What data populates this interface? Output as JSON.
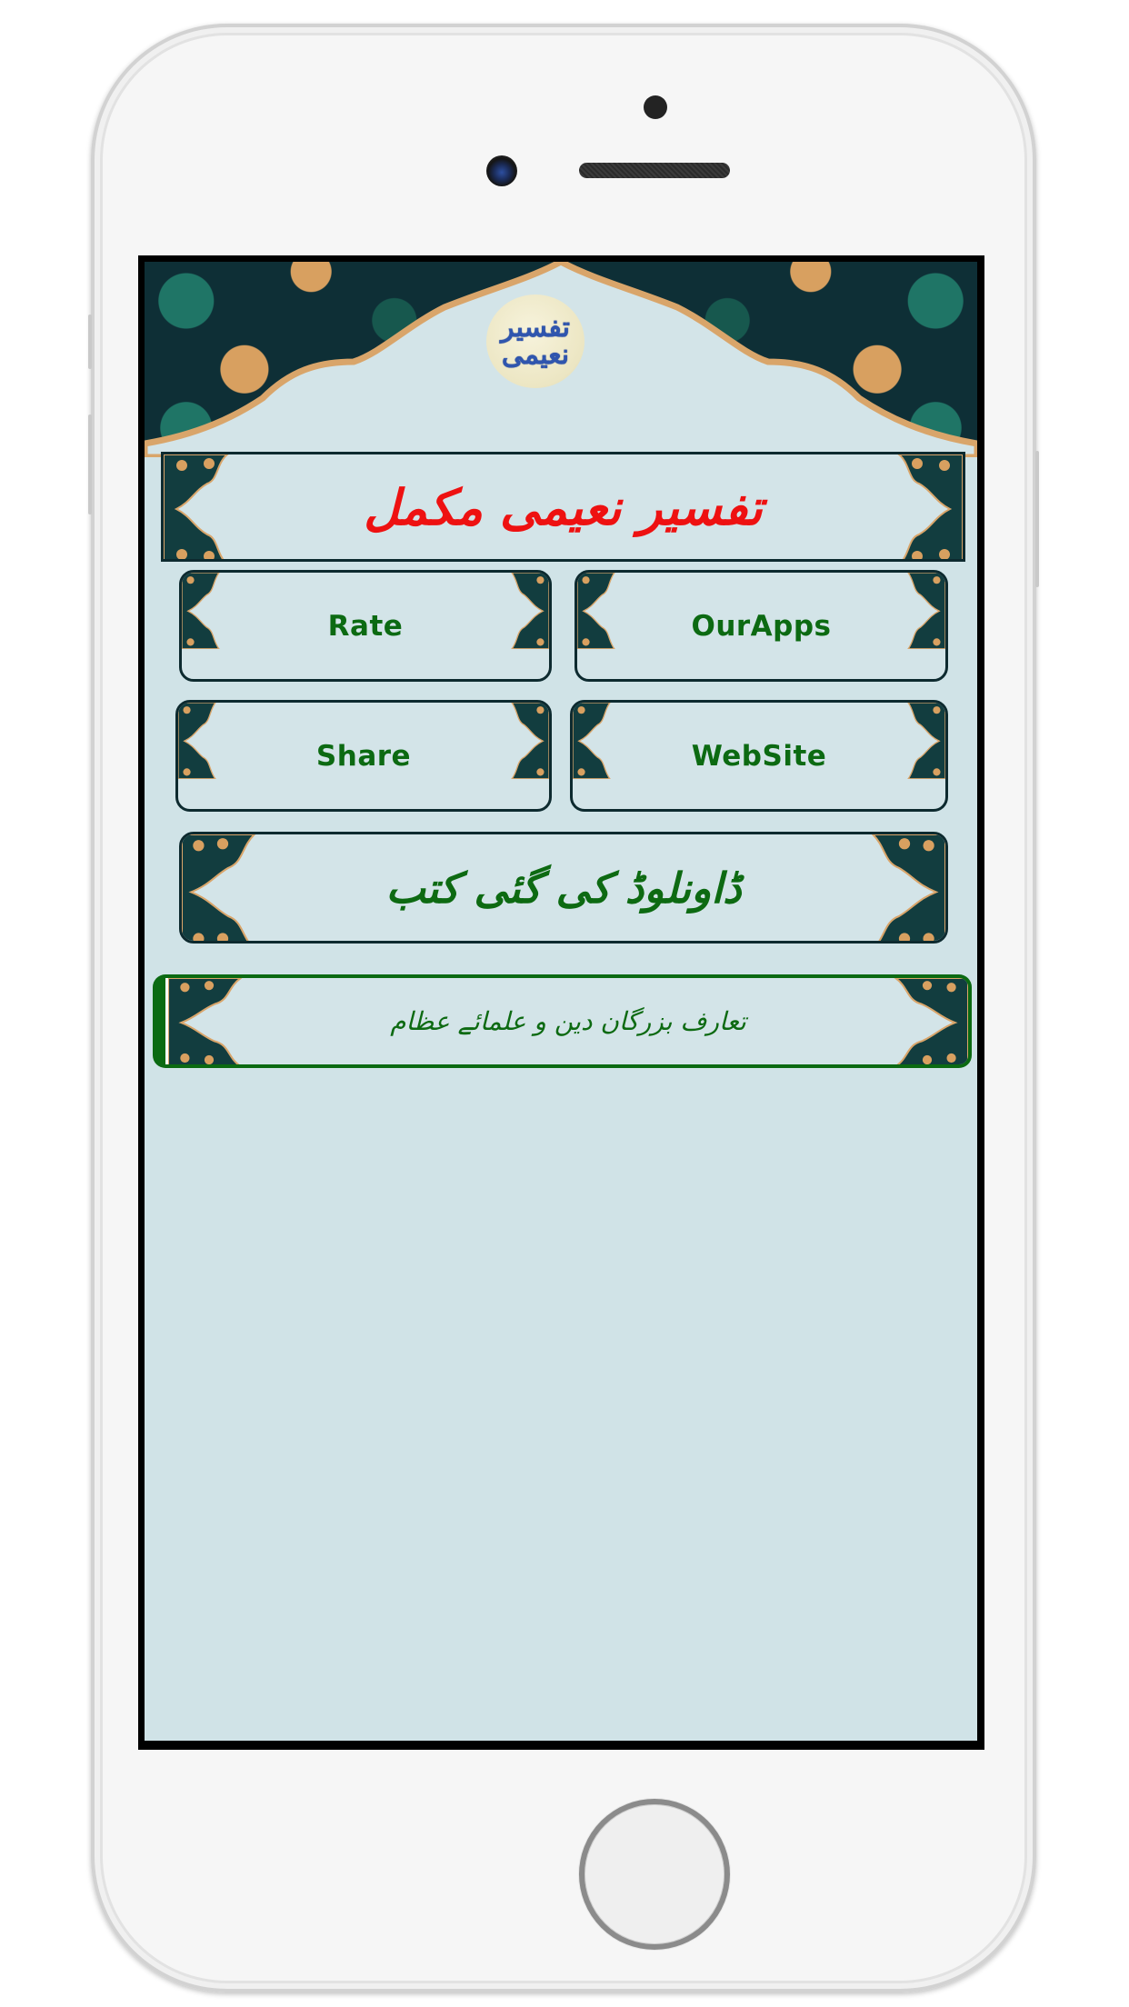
{
  "app": {
    "logo_text": "تفسیر نعیمی",
    "title": "تفسیر نعیمی مکمل",
    "title_color": "#ee1111"
  },
  "buttons": {
    "rate": "Rate",
    "our_apps": "OurApps",
    "share": "Share",
    "website": "WebSite",
    "downloaded_books": "ڈاونلوڈ کی گئی کتب",
    "scholars_intro": "تعارف بزرگان دین و علمائے عظام"
  },
  "colors": {
    "button_text": "#0c6a12",
    "screen_background": "#d0e3e7",
    "ornament_teal": "#0e2f36",
    "ornament_gold": "#d8a060",
    "highlight_border": "#0b6a12"
  }
}
